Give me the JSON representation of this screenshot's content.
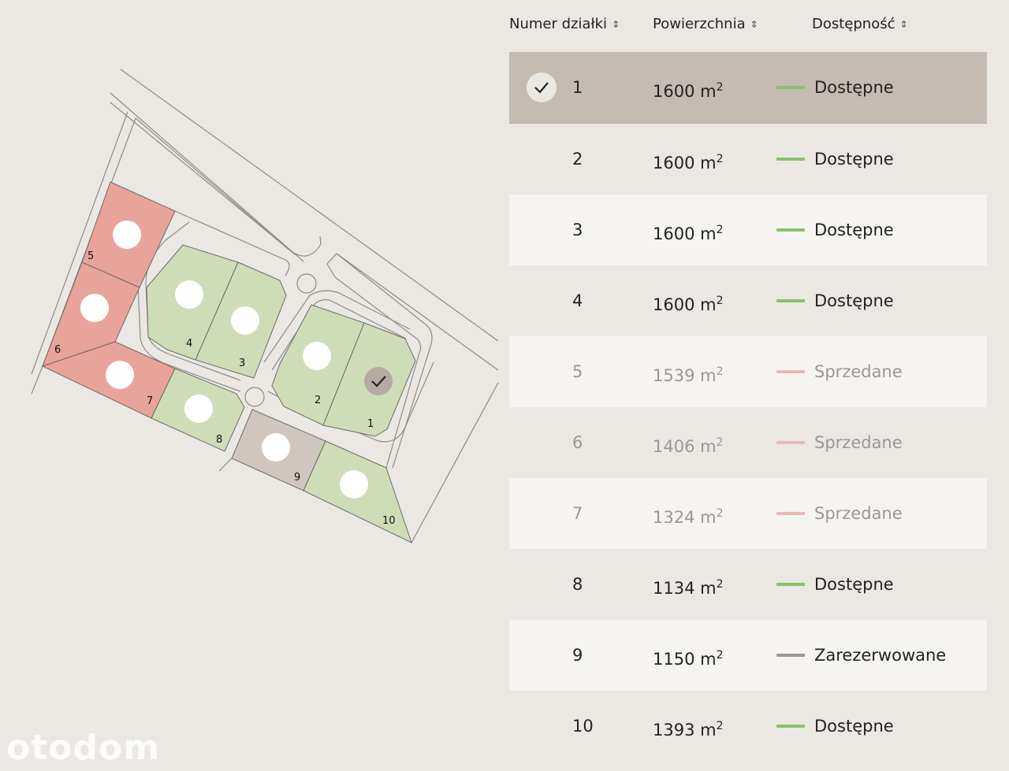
{
  "table": {
    "headers": {
      "number": "Numer działki",
      "area": "Powierzchnia",
      "availability": "Dostępność"
    },
    "sort_icon": "sort-updown-icon",
    "area_unit": "m",
    "area_unit_power": "2",
    "rows": [
      {
        "number": "1",
        "area": "1600",
        "status": "Dostępne",
        "state": "available",
        "selected": true
      },
      {
        "number": "2",
        "area": "1600",
        "status": "Dostępne",
        "state": "available",
        "selected": false
      },
      {
        "number": "3",
        "area": "1600",
        "status": "Dostępne",
        "state": "available",
        "selected": false
      },
      {
        "number": "4",
        "area": "1600",
        "status": "Dostępne",
        "state": "available",
        "selected": false
      },
      {
        "number": "5",
        "area": "1539",
        "status": "Sprzedane",
        "state": "sold",
        "selected": false
      },
      {
        "number": "6",
        "area": "1406",
        "status": "Sprzedane",
        "state": "sold",
        "selected": false
      },
      {
        "number": "7",
        "area": "1324",
        "status": "Sprzedane",
        "state": "sold",
        "selected": false
      },
      {
        "number": "8",
        "area": "1134",
        "status": "Dostępne",
        "state": "available",
        "selected": false
      },
      {
        "number": "9",
        "area": "1150",
        "status": "Zarezerwowane",
        "state": "reserved",
        "selected": false
      },
      {
        "number": "10",
        "area": "1393",
        "status": "Dostępne",
        "state": "available",
        "selected": false
      }
    ]
  },
  "map": {
    "plot_labels": [
      "1",
      "2",
      "3",
      "4",
      "5",
      "6",
      "7",
      "8",
      "9",
      "10"
    ],
    "selected_plot": "1"
  },
  "colors": {
    "available": "#8cc06b",
    "sold": "#e9b9b5",
    "reserved": "#9b9794",
    "plot_available_fill": "#cfdcb8",
    "plot_sold_fill": "#e8a39a",
    "plot_reserved_fill": "#cfc6bf",
    "selected_row": "#c4bbb2",
    "background": "#ebe8e3"
  },
  "watermark": "otodom"
}
